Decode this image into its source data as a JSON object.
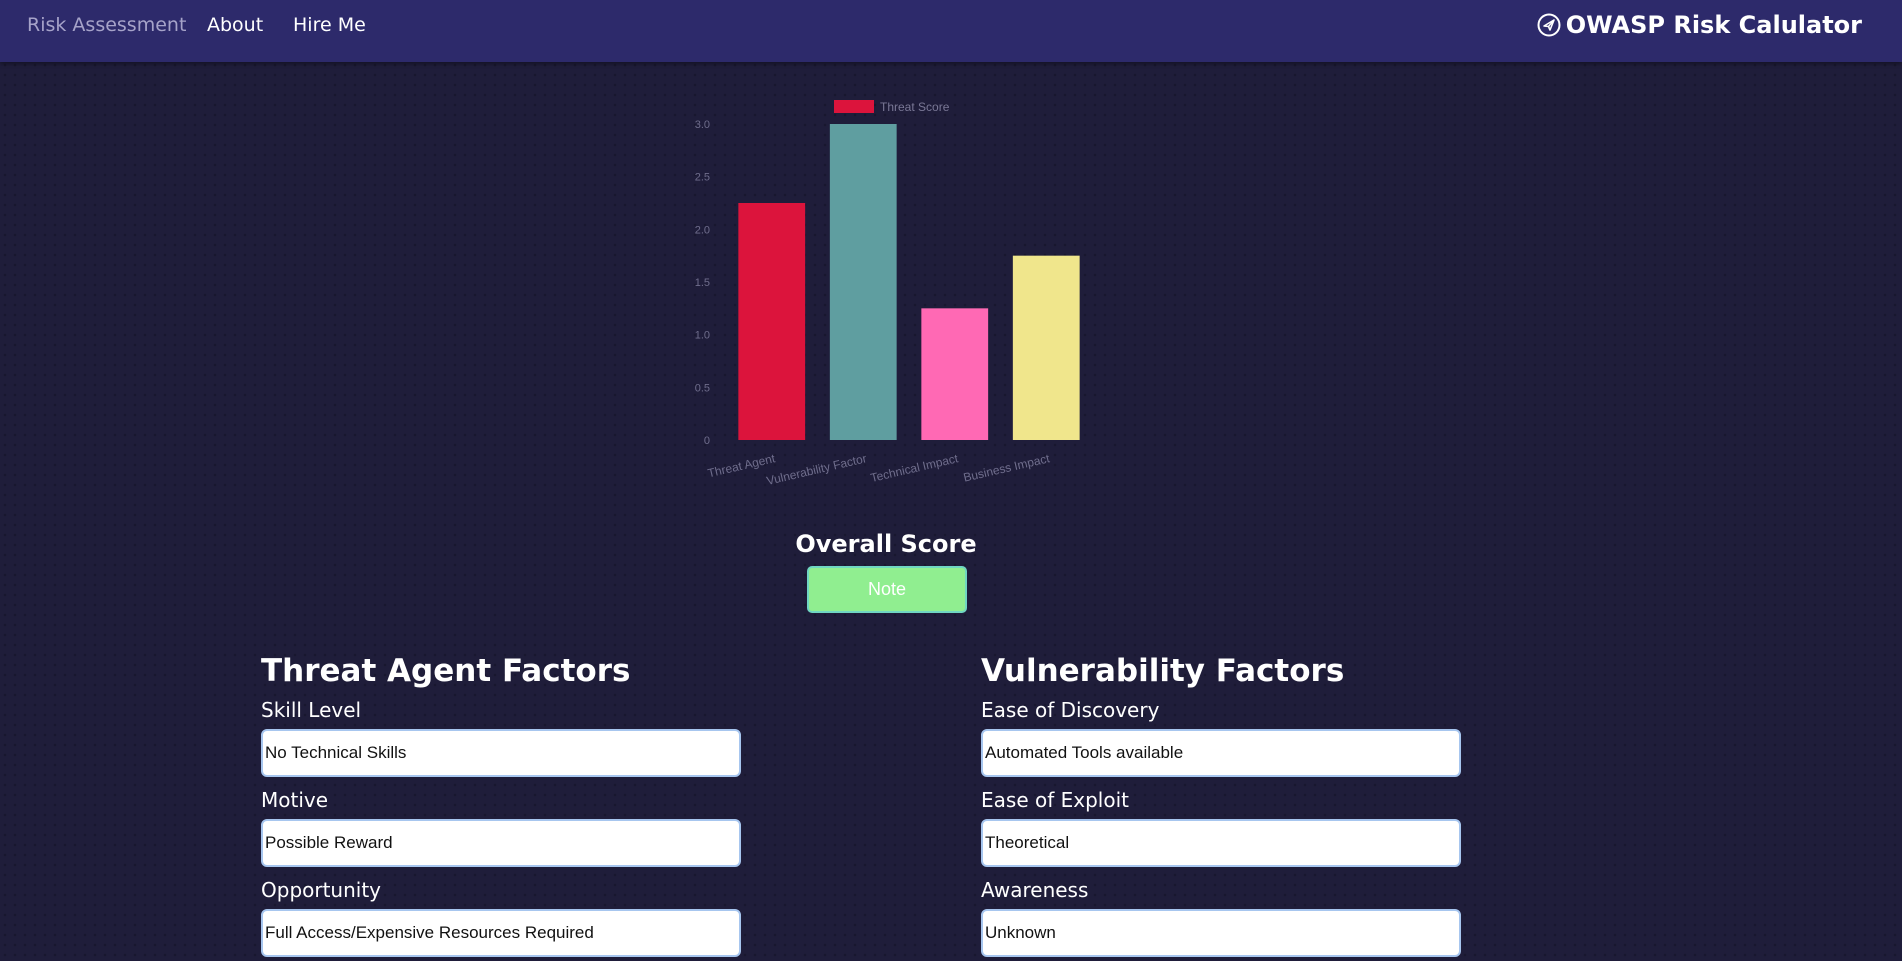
{
  "nav": {
    "links": [
      {
        "label": "Risk Assessment"
      },
      {
        "label": "About"
      },
      {
        "label": "Hire Me"
      }
    ],
    "brand": {
      "icon": "paper-plane-circle-icon",
      "title": "OWASP Risk Calulator"
    }
  },
  "chart_data": {
    "type": "bar",
    "categories": [
      "Threat Agent",
      "Vulnerability Factor",
      "Technical Impact",
      "Business Impact"
    ],
    "series": [
      {
        "name": "Threat Score",
        "values": [
          2.25,
          3.0,
          1.25,
          1.75
        ]
      }
    ],
    "bar_colors": [
      "#dc143c",
      "#5f9ea0",
      "#ff69b4",
      "#f0e68c"
    ],
    "legend_color": "#dc143c",
    "legend_position": "top",
    "ylim": [
      0,
      3.0
    ],
    "yticks": [
      "0",
      "0.5",
      "1.0",
      "1.5",
      "2.0",
      "2.5",
      "3.0"
    ],
    "title": "",
    "xlabel": "",
    "ylabel": "",
    "grid": false
  },
  "overall": {
    "title": "Overall Score",
    "button_label": "Note",
    "button_color": "#90ee90"
  },
  "threat_agent": {
    "title": "Threat Agent Factors",
    "fields": [
      {
        "label": "Skill Level",
        "value": "No Technical Skills"
      },
      {
        "label": "Motive",
        "value": "Possible Reward"
      },
      {
        "label": "Opportunity",
        "value": "Full Access/Expensive Resources Required"
      }
    ]
  },
  "vulnerability": {
    "title": "Vulnerability Factors",
    "fields": [
      {
        "label": "Ease of Discovery",
        "value": "Automated Tools available"
      },
      {
        "label": "Ease of Exploit",
        "value": "Theoretical"
      },
      {
        "label": "Awareness",
        "value": "Unknown"
      }
    ]
  }
}
